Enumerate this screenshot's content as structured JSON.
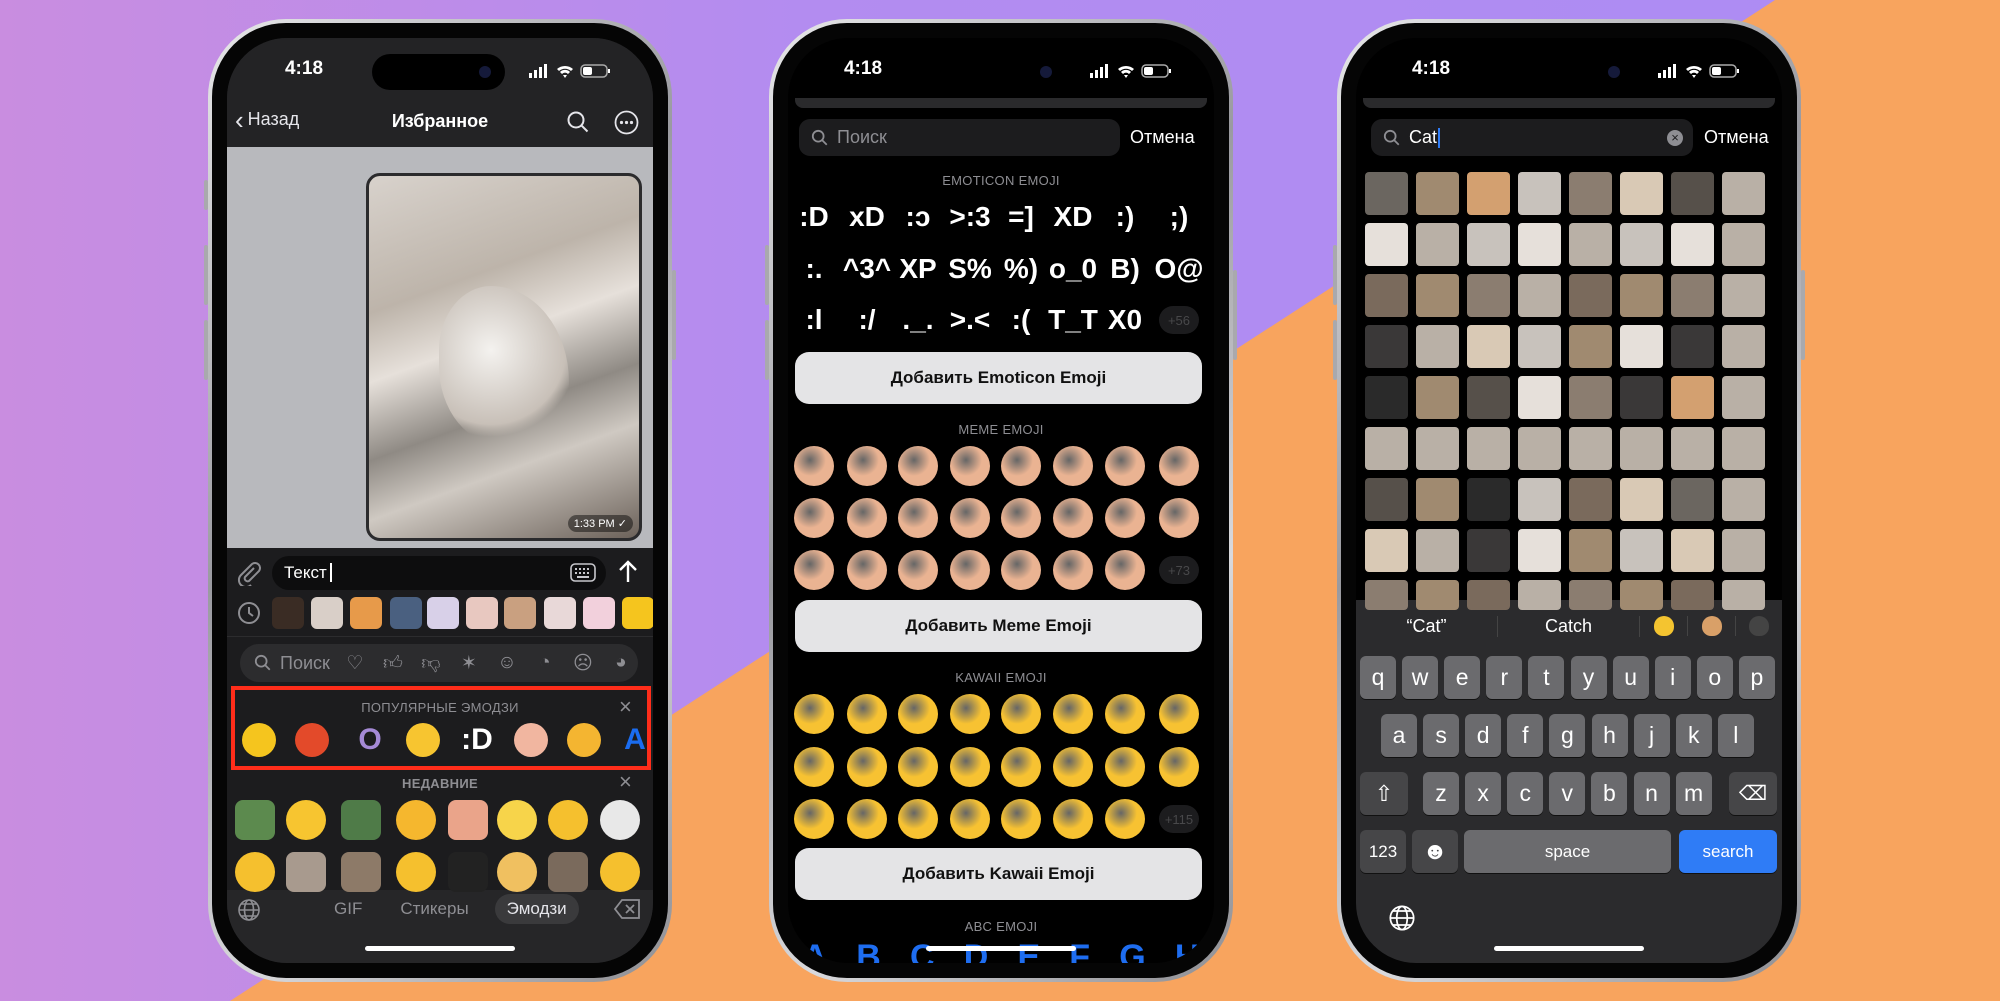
{
  "colors": {
    "bg_left": "#c98de0",
    "bg_mid": "#b38cf0",
    "bg_orange": "#f8a45e",
    "highlight": "#ff2d1a",
    "accent_blue": "#2f7cf6"
  },
  "status_bar": {
    "time": "4:18",
    "icons": [
      "cellular-signal-icon",
      "wifi-icon",
      "battery-icon"
    ]
  },
  "phone1": {
    "nav": {
      "back": "Назад",
      "title": "Избранное",
      "icons": [
        "search-icon",
        "more-icon"
      ]
    },
    "message": {
      "time": "1:33 PM",
      "status": "read-check-icon"
    },
    "input": {
      "value": "Текст"
    },
    "emoji_search_placeholder": "Поиск",
    "category_icons": [
      "heart-icon",
      "thumbs-up-icon",
      "thumbs-down-icon",
      "party-icon",
      "smile-icon",
      "worried-icon",
      "sad-icon",
      "angry-icon"
    ],
    "popular": {
      "title": "ПОПУЛЯРНЫЕ ЭМОДЗИ",
      "items": [
        {
          "name": "duck-emoji",
          "color": "#f5c51e"
        },
        {
          "name": "laughing-emoji",
          "color": "#e34a2a"
        },
        {
          "name": "letter-o-emoji",
          "color": "#a58ad6"
        },
        {
          "name": "slight-smile-emoji",
          "color": "#f7c530"
        },
        {
          "name": "colon-d-emoji",
          "color": "#ffffff"
        },
        {
          "name": "grin-emoji",
          "color": "#f1b6a0"
        },
        {
          "name": "cheer-emoji",
          "color": "#f4b531"
        },
        {
          "name": "letter-a-emoji",
          "color": "#1a6cf0"
        }
      ]
    },
    "recent": {
      "title": "НЕДАВНИЕ",
      "items": [
        {
          "name": "frog-tongue-sticker",
          "color": "#5c8a4e"
        },
        {
          "name": "tongue-emoji",
          "color": "#f7c530"
        },
        {
          "name": "frog-crying-sticker",
          "color": "#4f7b48"
        },
        {
          "name": "hug-emoji",
          "color": "#f5b72e"
        },
        {
          "name": "face-hands-sticker",
          "color": "#eaa48a"
        },
        {
          "name": "sparkles-emoji",
          "color": "#f7d44a"
        },
        {
          "name": "pleading-emoji",
          "color": "#f5c02e"
        },
        {
          "name": "skull-emoji",
          "color": "#e8e8e8"
        },
        {
          "name": "pensive-emoji",
          "color": "#f5c02e"
        },
        {
          "name": "crying-cat-sticker",
          "color": "#a89a8e"
        },
        {
          "name": "cat-paw-sticker",
          "color": "#8d7a68"
        },
        {
          "name": "salute-emoji",
          "color": "#f5c02e"
        },
        {
          "name": "black-cat-sticker",
          "color": "#222222"
        },
        {
          "name": "nail-polish-emoji",
          "color": "#f0c060"
        },
        {
          "name": "cat-standing-sticker",
          "color": "#7a6a5c"
        },
        {
          "name": "star-struck-emoji",
          "color": "#f5c02e"
        }
      ]
    },
    "stickers": [
      "#3a2c24",
      "#d9cfc8",
      "#e79a4a",
      "#4a6080",
      "#d8d0e8",
      "#e8c8c0",
      "#c9a080",
      "#e8d8d8",
      "#f2d0dc",
      "#f5c51e"
    ],
    "tabs": [
      {
        "label": "GIF"
      },
      {
        "label": "Стикеры"
      },
      {
        "label": "Эмодзи",
        "active": true
      }
    ]
  },
  "phone2": {
    "search": {
      "placeholder": "Поиск"
    },
    "cancel": "Отмена",
    "emoticon": {
      "title": "EMOTICON EMOJI",
      "rows": [
        [
          ":D",
          "xD",
          ":ↄ",
          ">:3",
          "=]",
          "XD",
          ":)",
          ";)"
        ],
        [
          ":.",
          "^3^",
          "XP",
          "S%",
          "%)",
          "o_0",
          "B)",
          "O@"
        ],
        [
          ":l",
          ":/",
          "._.",
          ">.<",
          ":(",
          "T_T",
          "X0"
        ]
      ],
      "more": "+56",
      "button": "Добавить Emoticon Emoji"
    },
    "meme": {
      "title": "MEME EMOJI",
      "more": "+73",
      "button": "Добавить Meme Emoji",
      "color": "#eab392"
    },
    "kawaii": {
      "title": "KAWAII EMOJI",
      "more": "+115",
      "button": "Добавить Kawaii Emoji",
      "color": "#f7c232"
    },
    "abc": {
      "title": "ABC EMOJI",
      "letters": [
        "A",
        "B",
        "C",
        "D",
        "E",
        "F",
        "G",
        "H"
      ]
    }
  },
  "phone3": {
    "search": {
      "value": "Cat"
    },
    "cancel": "Отмена",
    "suggestions": [
      "“Cat”",
      "Catch"
    ],
    "suggestion_emoji": [
      "cat-face-emoji",
      "cat-emoji",
      "black-cat-emoji"
    ],
    "keyboard": {
      "rows": [
        [
          "q",
          "w",
          "e",
          "r",
          "t",
          "y",
          "u",
          "i",
          "o",
          "p"
        ],
        [
          "a",
          "s",
          "d",
          "f",
          "g",
          "h",
          "j",
          "k",
          "l"
        ],
        [
          "z",
          "x",
          "c",
          "v",
          "b",
          "n",
          "m"
        ]
      ],
      "numbers": "123",
      "space": "space",
      "action": "search"
    }
  }
}
